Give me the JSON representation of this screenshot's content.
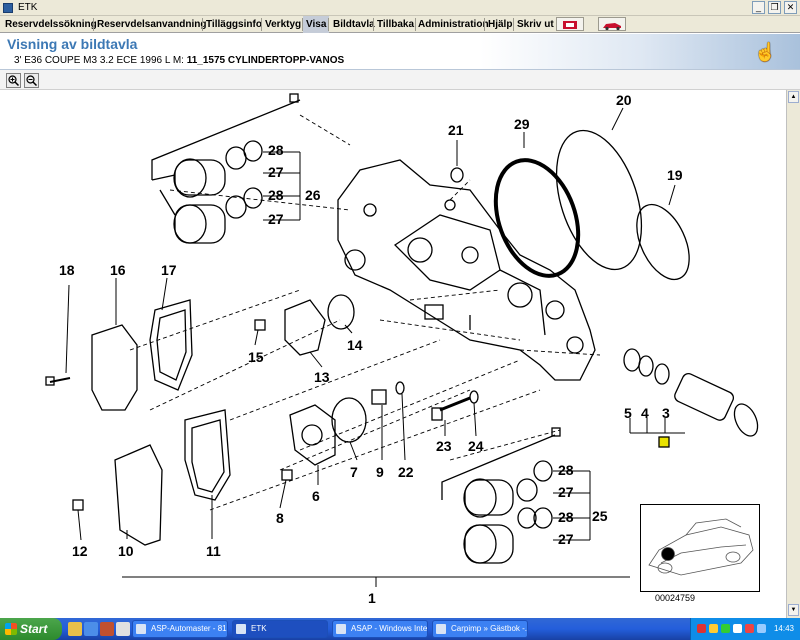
{
  "window": {
    "title": "ETK"
  },
  "menu": [
    "Reservdelssökning",
    "Reservdelsanvandning",
    "Tilläggsinfo",
    "Verktyg",
    "Visa",
    "Bildtavla",
    "Tillbaka",
    "Administration",
    "Hjälp",
    "Skriv ut"
  ],
  "header": {
    "title": "Visning av bildtavla",
    "vehicle": "3' E36 COUPE M3 3.2 ECE 1996  L M:",
    "diagram": "11_1575 CYLINDERTOPP-VANOS"
  },
  "diagram": {
    "callouts": [
      "1",
      "3",
      "4",
      "5",
      "6",
      "7",
      "8",
      "9",
      "10",
      "11",
      "12",
      "13",
      "14",
      "15",
      "16",
      "17",
      "18",
      "19",
      "20",
      "21",
      "22",
      "23",
      "24",
      "25",
      "26",
      "27",
      "28",
      "29"
    ],
    "callout_28_a": "28",
    "callout_27_a": "27",
    "callout_28_b": "28",
    "callout_27_b": "27",
    "callout_28_c": "28",
    "callout_27_c": "27",
    "callout_28_d": "28",
    "callout_27_d": "27",
    "image_number": "00024759"
  },
  "taskbar": {
    "start": "Start",
    "tasks": [
      "ASP-Automaster - 81...",
      "ETK",
      "ASAP - Windows Inte...",
      "Carpimp » Gästbok -..."
    ],
    "clock": "14:43"
  }
}
